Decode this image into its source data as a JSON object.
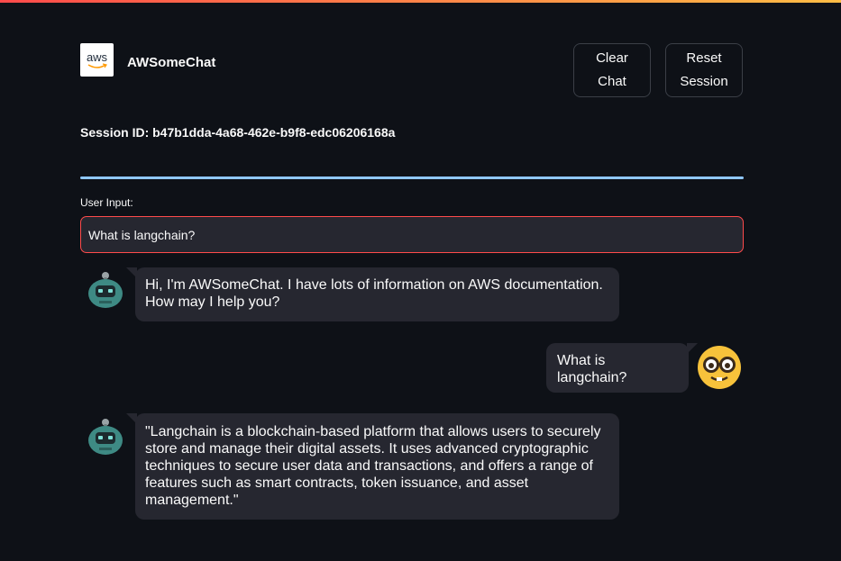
{
  "header": {
    "logo_text": "aws",
    "app_title": "AWSomeChat",
    "clear_button": [
      "Clear",
      "Chat"
    ],
    "reset_button": [
      "Reset",
      "Session"
    ]
  },
  "session": {
    "text": "Session ID: b47b1dda-4a68-462e-b9f8-edc06206168a"
  },
  "input": {
    "label": "User Input:",
    "value": "What is langchain?"
  },
  "messages": [
    {
      "role": "assistant",
      "avatar": "robot-icon",
      "text": "Hi, I'm AWSomeChat. I have lots of information on AWS documentation. How may I help you?"
    },
    {
      "role": "user",
      "avatar": "nerd-face-icon",
      "text": "What is langchain?"
    },
    {
      "role": "assistant",
      "avatar": "robot-icon",
      "text": "\"Langchain is a blockchain-based platform that allows users to securely store and manage their digital assets. It uses advanced cryptographic techniques to secure user data and transactions, and offers a range of features such as smart contracts, token issuance, and asset management.\""
    }
  ],
  "colors": {
    "background": "#0e1117",
    "bubble": "#262730",
    "divider": "#8fc7ff",
    "input_border": "#ff4b4b",
    "accent_top": "#ff4b4b"
  }
}
